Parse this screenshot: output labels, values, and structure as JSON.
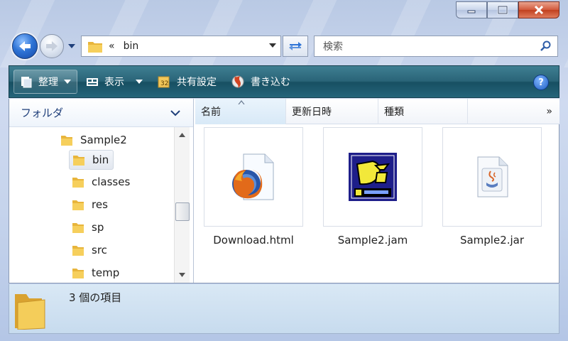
{
  "window": {
    "caption_buttons": {
      "minimize": "minimize-icon",
      "maximize": "maximize-icon",
      "close": "close-icon"
    }
  },
  "nav": {
    "address_chevron": "«",
    "address_path": "bin",
    "search_placeholder": "検索"
  },
  "toolbar": {
    "organize": "整理",
    "views": "表示",
    "share": "共有設定",
    "burn": "書き込む",
    "help": "?"
  },
  "folders_pane": {
    "header": "フォルダ",
    "tree": [
      {
        "label": "Sample2",
        "selected": false
      },
      {
        "label": "bin",
        "selected": true
      },
      {
        "label": "classes",
        "selected": false
      },
      {
        "label": "res",
        "selected": false
      },
      {
        "label": "sp",
        "selected": false
      },
      {
        "label": "src",
        "selected": false
      },
      {
        "label": "temp",
        "selected": false
      }
    ]
  },
  "columns": {
    "name": "名前",
    "date": "更新日時",
    "type": "種類",
    "more": "»"
  },
  "files": [
    {
      "name": "Download.html",
      "icon": "firefox-html-icon"
    },
    {
      "name": "Sample2.jam",
      "icon": "doja-app-icon"
    },
    {
      "name": "Sample2.jar",
      "icon": "java-jar-icon"
    }
  ],
  "status": {
    "count_text": "3 個の項目"
  },
  "colors": {
    "toolbar": "#2a6478",
    "accent": "#2f74d6",
    "close": "#c0401f"
  }
}
